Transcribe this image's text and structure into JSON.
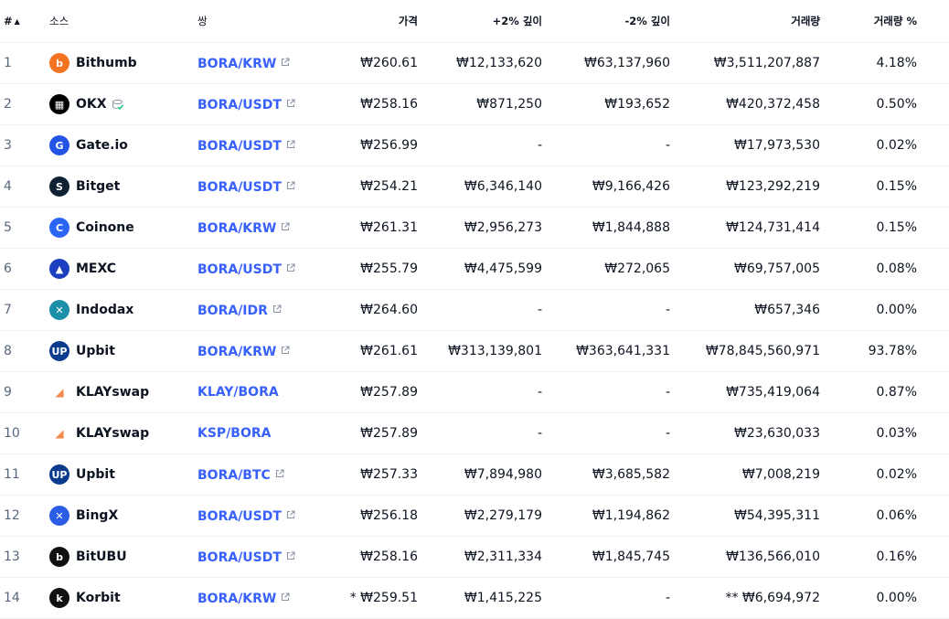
{
  "headers": {
    "rank": "#",
    "source": "소스",
    "pair": "쌍",
    "price": "가격",
    "depth_plus": "+2% 깊이",
    "depth_minus": "-2% 깊이",
    "volume": "거래량",
    "volume_pct": "거래량 %"
  },
  "rows": [
    {
      "rank": "1",
      "name": "Bithumb",
      "logo": "bithumb-logo-icon",
      "color": "#f37321",
      "pair": "BORA/KRW",
      "pair_link": true,
      "price": "₩260.61",
      "plus": "₩12,133,620",
      "minus": "₩63,137,960",
      "volume": "₩3,511,207,887",
      "pct": "4.18%"
    },
    {
      "rank": "2",
      "name": "OKX",
      "logo": "okx-logo-icon",
      "color": "#000000",
      "verified": true,
      "pair": "BORA/USDT",
      "pair_link": true,
      "price": "₩258.16",
      "plus": "₩871,250",
      "minus": "₩193,652",
      "volume": "₩420,372,458",
      "pct": "0.50%"
    },
    {
      "rank": "3",
      "name": "Gate.io",
      "logo": "gateio-logo-icon",
      "color": "#2354e6",
      "pair": "BORA/USDT",
      "pair_link": true,
      "price": "₩256.99",
      "plus": "-",
      "minus": "-",
      "volume": "₩17,973,530",
      "pct": "0.02%"
    },
    {
      "rank": "4",
      "name": "Bitget",
      "logo": "bitget-logo-icon",
      "color": "#0f2133",
      "pair": "BORA/USDT",
      "pair_link": true,
      "price": "₩254.21",
      "plus": "₩6,346,140",
      "minus": "₩9,166,426",
      "volume": "₩123,292,219",
      "pct": "0.15%"
    },
    {
      "rank": "5",
      "name": "Coinone",
      "logo": "coinone-logo-icon",
      "color": "#2a65f4",
      "pair": "BORA/KRW",
      "pair_link": true,
      "price": "₩261.31",
      "plus": "₩2,956,273",
      "minus": "₩1,844,888",
      "volume": "₩124,731,414",
      "pct": "0.15%"
    },
    {
      "rank": "6",
      "name": "MEXC",
      "logo": "mexc-logo-icon",
      "color": "#1b3fbf",
      "pair": "BORA/USDT",
      "pair_link": true,
      "price": "₩255.79",
      "plus": "₩4,475,599",
      "minus": "₩272,065",
      "volume": "₩69,757,005",
      "pct": "0.08%"
    },
    {
      "rank": "7",
      "name": "Indodax",
      "logo": "indodax-logo-icon",
      "color": "#1c8fa8",
      "pair": "BORA/IDR",
      "pair_link": true,
      "price": "₩264.60",
      "plus": "-",
      "minus": "-",
      "volume": "₩657,346",
      "pct": "0.00%"
    },
    {
      "rank": "8",
      "name": "Upbit",
      "logo": "upbit-logo-icon",
      "color": "#0a3b8c",
      "pair": "BORA/KRW",
      "pair_link": true,
      "price": "₩261.61",
      "plus": "₩313,139,801",
      "minus": "₩363,641,331",
      "volume": "₩78,845,560,971",
      "pct": "93.78%"
    },
    {
      "rank": "9",
      "name": "KLAYswap",
      "logo": "klayswap-logo-icon",
      "color": "#f28b4a",
      "pair": "KLAY/BORA",
      "pair_link": false,
      "price": "₩257.89",
      "plus": "-",
      "minus": "-",
      "volume": "₩735,419,064",
      "pct": "0.87%"
    },
    {
      "rank": "10",
      "name": "KLAYswap",
      "logo": "klayswap-logo-icon",
      "color": "#f28b4a",
      "pair": "KSP/BORA",
      "pair_link": false,
      "price": "₩257.89",
      "plus": "-",
      "minus": "-",
      "volume": "₩23,630,033",
      "pct": "0.03%"
    },
    {
      "rank": "11",
      "name": "Upbit",
      "logo": "upbit-logo-icon",
      "color": "#0a3b8c",
      "pair": "BORA/BTC",
      "pair_link": true,
      "price": "₩257.33",
      "plus": "₩7,894,980",
      "minus": "₩3,685,582",
      "volume": "₩7,008,219",
      "pct": "0.02%"
    },
    {
      "rank": "12",
      "name": "BingX",
      "logo": "bingx-logo-icon",
      "color": "#2b5ce6",
      "pair": "BORA/USDT",
      "pair_link": true,
      "price": "₩256.18",
      "plus": "₩2,279,179",
      "minus": "₩1,194,862",
      "volume": "₩54,395,311",
      "pct": "0.06%"
    },
    {
      "rank": "13",
      "name": "BitUBU",
      "logo": "bitubu-logo-icon",
      "color": "#111111",
      "pair": "BORA/USDT",
      "pair_link": true,
      "price": "₩258.16",
      "plus": "₩2,311,334",
      "minus": "₩1,845,745",
      "volume": "₩136,566,010",
      "pct": "0.16%"
    },
    {
      "rank": "14",
      "name": "Korbit",
      "logo": "korbit-logo-icon",
      "color": "#111111",
      "pair": "BORA/KRW",
      "pair_link": true,
      "price": "* ₩259.51",
      "plus": "₩1,415,225",
      "minus": "-",
      "volume": "** ₩6,694,972",
      "pct": "0.00%"
    }
  ]
}
